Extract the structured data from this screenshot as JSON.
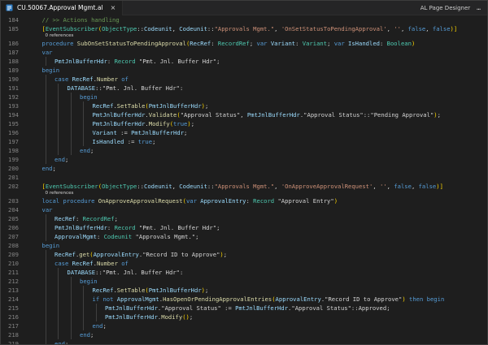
{
  "tab": {
    "title": "CU.50067.Approval Mgmt.al",
    "close_glyph": "×",
    "icon": "file-icon"
  },
  "toolbar": {
    "designer_label": "AL Page Designer",
    "more_glyph": "…"
  },
  "colors": {
    "keyword": "#569cd6",
    "type": "#4ec9b0",
    "string": "#ce9178",
    "function": "#dcdcaa",
    "identifier": "#9cdcfe",
    "comment": "#6a9955"
  },
  "lines": [
    {
      "kind": "code",
      "ln": "184",
      "indent": 1,
      "tokens": [
        [
          "cm",
          "// >> Actions handling"
        ]
      ]
    },
    {
      "kind": "code",
      "ln": "185",
      "indent": 1,
      "tokens": [
        [
          "br",
          "["
        ],
        [
          "ty",
          "EventSubscriber"
        ],
        [
          "br",
          "("
        ],
        [
          "ty",
          "ObjectType"
        ],
        [
          "pl",
          "::"
        ],
        [
          "id",
          "Codeunit"
        ],
        [
          "pl",
          ", "
        ],
        [
          "id",
          "Codeunit"
        ],
        [
          "pl",
          "::"
        ],
        [
          "str",
          "\"Approvals Mgmt.\""
        ],
        [
          "pl",
          ", "
        ],
        [
          "str",
          "'OnSetStatusToPendingApproval'"
        ],
        [
          "pl",
          ", "
        ],
        [
          "str",
          "''"
        ],
        [
          "pl",
          ", "
        ],
        [
          "kw",
          "false"
        ],
        [
          "pl",
          ", "
        ],
        [
          "kw",
          "false"
        ],
        [
          "br",
          ")"
        ],
        [
          "br",
          "]"
        ]
      ]
    },
    {
      "kind": "lens",
      "text": "0 references"
    },
    {
      "kind": "code",
      "ln": "186",
      "indent": 1,
      "tokens": [
        [
          "kw",
          "procedure "
        ],
        [
          "fn",
          "SubOnSetStatusToPendingApproval"
        ],
        [
          "br",
          "("
        ],
        [
          "id",
          "RecRef"
        ],
        [
          "pl",
          ": "
        ],
        [
          "ty",
          "RecordRef"
        ],
        [
          "pl",
          "; "
        ],
        [
          "kw",
          "var "
        ],
        [
          "id",
          "Variant"
        ],
        [
          "pl",
          ": "
        ],
        [
          "ty",
          "Variant"
        ],
        [
          "pl",
          "; "
        ],
        [
          "kw",
          "var "
        ],
        [
          "id",
          "IsHandled"
        ],
        [
          "pl",
          ": "
        ],
        [
          "ty",
          "Boolean"
        ],
        [
          "br",
          ")"
        ]
      ]
    },
    {
      "kind": "code",
      "ln": "187",
      "indent": 1,
      "tokens": [
        [
          "kw",
          "var"
        ]
      ]
    },
    {
      "kind": "code",
      "ln": "188",
      "indent": 2,
      "tokens": [
        [
          "id",
          "PmtJnlBufferHdr"
        ],
        [
          "pl",
          ": "
        ],
        [
          "ty",
          "Record "
        ],
        [
          "pl",
          "\"Pmt. Jnl. Buffer Hdr\";"
        ]
      ]
    },
    {
      "kind": "code",
      "ln": "189",
      "indent": 1,
      "tokens": [
        [
          "kw",
          "begin"
        ]
      ]
    },
    {
      "kind": "code",
      "ln": "190",
      "indent": 2,
      "tokens": [
        [
          "kw",
          "case "
        ],
        [
          "id",
          "RecRef"
        ],
        [
          "pl",
          "."
        ],
        [
          "fn",
          "Number "
        ],
        [
          "kw",
          "of"
        ]
      ]
    },
    {
      "kind": "code",
      "ln": "191",
      "indent": 3,
      "tokens": [
        [
          "id",
          "DATABASE"
        ],
        [
          "pl",
          "::\"Pmt. Jnl. Buffer Hdr\":"
        ]
      ]
    },
    {
      "kind": "code",
      "ln": "192",
      "indent": 4,
      "tokens": [
        [
          "kw",
          "begin"
        ]
      ]
    },
    {
      "kind": "code",
      "ln": "193",
      "indent": 5,
      "tokens": [
        [
          "id",
          "RecRef"
        ],
        [
          "pl",
          "."
        ],
        [
          "fn",
          "SetTable"
        ],
        [
          "br",
          "("
        ],
        [
          "id",
          "PmtJnlBufferHdr"
        ],
        [
          "br",
          ")"
        ],
        [
          "pl",
          ";"
        ]
      ]
    },
    {
      "kind": "code",
      "ln": "194",
      "indent": 5,
      "tokens": [
        [
          "id",
          "PmtJnlBufferHdr"
        ],
        [
          "pl",
          "."
        ],
        [
          "fn",
          "Validate"
        ],
        [
          "br",
          "("
        ],
        [
          "pl",
          "\"Approval Status\", "
        ],
        [
          "id",
          "PmtJnlBufferHdr"
        ],
        [
          "pl",
          ".\"Approval Status\"::\"Pending Approval\""
        ],
        [
          "br",
          ")"
        ],
        [
          "pl",
          ";"
        ]
      ]
    },
    {
      "kind": "code",
      "ln": "195",
      "indent": 5,
      "tokens": [
        [
          "id",
          "PmtJnlBufferHdr"
        ],
        [
          "pl",
          "."
        ],
        [
          "fn",
          "Modify"
        ],
        [
          "br",
          "("
        ],
        [
          "kw",
          "true"
        ],
        [
          "br",
          ")"
        ],
        [
          "pl",
          ";"
        ]
      ]
    },
    {
      "kind": "code",
      "ln": "196",
      "indent": 5,
      "tokens": [
        [
          "id",
          "Variant"
        ],
        [
          "pl",
          " := "
        ],
        [
          "id",
          "PmtJnlBufferHdr"
        ],
        [
          "pl",
          ";"
        ]
      ]
    },
    {
      "kind": "code",
      "ln": "197",
      "indent": 5,
      "tokens": [
        [
          "id",
          "IsHandled"
        ],
        [
          "pl",
          " := "
        ],
        [
          "kw",
          "true"
        ],
        [
          "pl",
          ";"
        ]
      ]
    },
    {
      "kind": "code",
      "ln": "198",
      "indent": 4,
      "tokens": [
        [
          "kw",
          "end"
        ],
        [
          "pl",
          ";"
        ]
      ]
    },
    {
      "kind": "code",
      "ln": "199",
      "indent": 2,
      "tokens": [
        [
          "kw",
          "end"
        ],
        [
          "pl",
          ";"
        ]
      ]
    },
    {
      "kind": "code",
      "ln": "200",
      "indent": 1,
      "tokens": [
        [
          "kw",
          "end"
        ],
        [
          "pl",
          ";"
        ]
      ]
    },
    {
      "kind": "code",
      "ln": "201",
      "indent": 0,
      "tokens": []
    },
    {
      "kind": "code",
      "ln": "202",
      "indent": 1,
      "tokens": [
        [
          "br",
          "["
        ],
        [
          "ty",
          "EventSubscriber"
        ],
        [
          "br",
          "("
        ],
        [
          "ty",
          "ObjectType"
        ],
        [
          "pl",
          "::"
        ],
        [
          "id",
          "Codeunit"
        ],
        [
          "pl",
          ", "
        ],
        [
          "id",
          "Codeunit"
        ],
        [
          "pl",
          "::"
        ],
        [
          "str",
          "\"Approvals Mgmt.\""
        ],
        [
          "pl",
          ", "
        ],
        [
          "str",
          "'OnApproveApprovalRequest'"
        ],
        [
          "pl",
          ", "
        ],
        [
          "str",
          "''"
        ],
        [
          "pl",
          ", "
        ],
        [
          "kw",
          "false"
        ],
        [
          "pl",
          ", "
        ],
        [
          "kw",
          "false"
        ],
        [
          "br",
          ")"
        ],
        [
          "br",
          "]"
        ]
      ]
    },
    {
      "kind": "lens",
      "text": "0 references"
    },
    {
      "kind": "code",
      "ln": "203",
      "indent": 1,
      "tokens": [
        [
          "kw",
          "local procedure "
        ],
        [
          "fn",
          "OnApproveApprovalRequest"
        ],
        [
          "br",
          "("
        ],
        [
          "kw",
          "var "
        ],
        [
          "id",
          "ApprovalEntry"
        ],
        [
          "pl",
          ": "
        ],
        [
          "ty",
          "Record "
        ],
        [
          "pl",
          "\"Approval Entry\""
        ],
        [
          "br",
          ")"
        ]
      ]
    },
    {
      "kind": "code",
      "ln": "204",
      "indent": 1,
      "tokens": [
        [
          "kw",
          "var"
        ]
      ]
    },
    {
      "kind": "code",
      "ln": "205",
      "indent": 2,
      "tokens": [
        [
          "id",
          "RecRef"
        ],
        [
          "pl",
          ": "
        ],
        [
          "ty",
          "RecordRef"
        ],
        [
          "pl",
          ";"
        ]
      ]
    },
    {
      "kind": "code",
      "ln": "206",
      "indent": 2,
      "tokens": [
        [
          "id",
          "PmtJnlBufferHdr"
        ],
        [
          "pl",
          ": "
        ],
        [
          "ty",
          "Record "
        ],
        [
          "pl",
          "\"Pmt. Jnl. Buffer Hdr\";"
        ]
      ]
    },
    {
      "kind": "code",
      "ln": "207",
      "indent": 2,
      "tokens": [
        [
          "id",
          "ApprovalMgmt"
        ],
        [
          "pl",
          ": "
        ],
        [
          "ty",
          "Codeunit "
        ],
        [
          "pl",
          "\"Approvals Mgmt.\";"
        ]
      ]
    },
    {
      "kind": "code",
      "ln": "208",
      "indent": 1,
      "tokens": [
        [
          "kw",
          "begin"
        ]
      ]
    },
    {
      "kind": "code",
      "ln": "209",
      "indent": 2,
      "tokens": [
        [
          "id",
          "RecRef"
        ],
        [
          "pl",
          "."
        ],
        [
          "fn",
          "get"
        ],
        [
          "br",
          "("
        ],
        [
          "id",
          "ApprovalEntry"
        ],
        [
          "pl",
          ".\"Record ID to Approve\""
        ],
        [
          "br",
          ")"
        ],
        [
          "pl",
          ";"
        ]
      ]
    },
    {
      "kind": "code",
      "ln": "210",
      "indent": 2,
      "tokens": [
        [
          "kw",
          "case "
        ],
        [
          "id",
          "RecRef"
        ],
        [
          "pl",
          "."
        ],
        [
          "fn",
          "Number "
        ],
        [
          "kw",
          "of"
        ]
      ]
    },
    {
      "kind": "code",
      "ln": "211",
      "indent": 3,
      "tokens": [
        [
          "id",
          "DATABASE"
        ],
        [
          "pl",
          "::\"Pmt. Jnl. Buffer Hdr\":"
        ]
      ]
    },
    {
      "kind": "code",
      "ln": "212",
      "indent": 4,
      "tokens": [
        [
          "kw",
          "begin"
        ]
      ]
    },
    {
      "kind": "code",
      "ln": "213",
      "indent": 5,
      "tokens": [
        [
          "id",
          "RecRef"
        ],
        [
          "pl",
          "."
        ],
        [
          "fn",
          "SetTable"
        ],
        [
          "br",
          "("
        ],
        [
          "id",
          "PmtJnlBufferHdr"
        ],
        [
          "br",
          ")"
        ],
        [
          "pl",
          ";"
        ]
      ]
    },
    {
      "kind": "code",
      "ln": "214",
      "indent": 5,
      "tokens": [
        [
          "kw",
          "if not "
        ],
        [
          "id",
          "ApprovalMgmt"
        ],
        [
          "pl",
          "."
        ],
        [
          "fn",
          "HasOpenOrPendingApprovalEntries"
        ],
        [
          "br",
          "("
        ],
        [
          "id",
          "ApprovalEntry"
        ],
        [
          "pl",
          ".\"Record ID to Approve\""
        ],
        [
          "br",
          ")"
        ],
        [
          "kw",
          " then begin"
        ]
      ]
    },
    {
      "kind": "code",
      "ln": "215",
      "indent": 6,
      "tokens": [
        [
          "id",
          "PmtJnlBufferHdr"
        ],
        [
          "pl",
          ".\"Approval Status\" := "
        ],
        [
          "id",
          "PmtJnlBufferHdr"
        ],
        [
          "pl",
          ".\"Approval Status\"::Approved;"
        ]
      ]
    },
    {
      "kind": "code",
      "ln": "216",
      "indent": 6,
      "tokens": [
        [
          "id",
          "PmtJnlBufferHdr"
        ],
        [
          "pl",
          "."
        ],
        [
          "fn",
          "Modify"
        ],
        [
          "br",
          "()"
        ],
        [
          "pl",
          ";"
        ]
      ]
    },
    {
      "kind": "code",
      "ln": "217",
      "indent": 5,
      "tokens": [
        [
          "kw",
          "end"
        ],
        [
          "pl",
          ";"
        ]
      ]
    },
    {
      "kind": "code",
      "ln": "218",
      "indent": 4,
      "tokens": [
        [
          "kw",
          "end"
        ],
        [
          "pl",
          ";"
        ]
      ]
    },
    {
      "kind": "code",
      "ln": "219",
      "indent": 2,
      "tokens": [
        [
          "kw",
          "end"
        ],
        [
          "pl",
          ";"
        ]
      ]
    },
    {
      "kind": "code",
      "ln": "220",
      "indent": 1,
      "tokens": [
        [
          "kw",
          "end"
        ],
        [
          "pl",
          ";"
        ]
      ]
    }
  ]
}
